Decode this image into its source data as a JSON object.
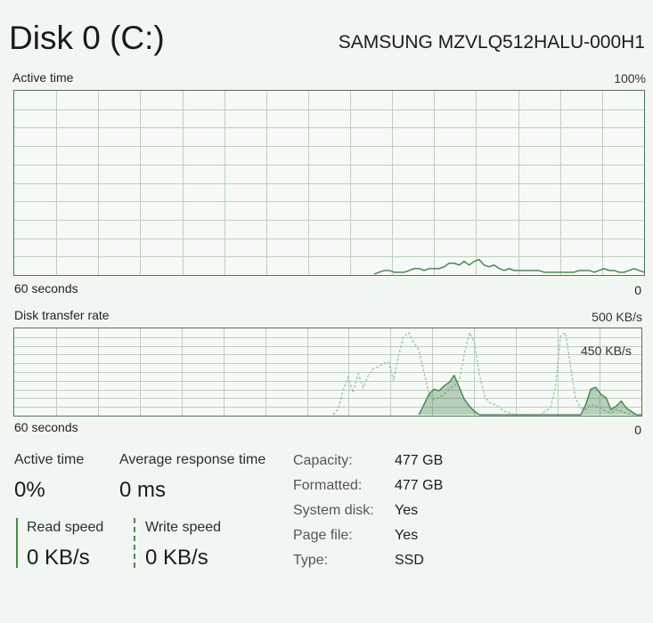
{
  "header": {
    "title": "Disk 0 (C:)",
    "model": "SAMSUNG MZVLQ512HALU-000H1"
  },
  "active_time_chart": {
    "label": "Active time",
    "max_label": "100%",
    "time_label": "60 seconds",
    "min_label": "0",
    "line_color": "#3f7d4a",
    "values": [
      0,
      0,
      0,
      0,
      0,
      0,
      0,
      0,
      0,
      0,
      0,
      0,
      0,
      0,
      0,
      0,
      0,
      0,
      0,
      0,
      0,
      0,
      0,
      0,
      0,
      0,
      0,
      0,
      0,
      0,
      0,
      0,
      0,
      0,
      0,
      0,
      0,
      0,
      0,
      0,
      0,
      0,
      0,
      0,
      0,
      0,
      0,
      0,
      0,
      0,
      0,
      0,
      0,
      0,
      0,
      0,
      0,
      0,
      0,
      0,
      0,
      0,
      0,
      0,
      0,
      0,
      0,
      0,
      0,
      0,
      0,
      0,
      0,
      1,
      2,
      2,
      1,
      1,
      1,
      2,
      3,
      3,
      2,
      3,
      3,
      3,
      4,
      6,
      6,
      5,
      7,
      5,
      7,
      8,
      5,
      4,
      5,
      3,
      2,
      3,
      2,
      2,
      2,
      2,
      2,
      2,
      1,
      1,
      1,
      1,
      1,
      1,
      1,
      2,
      2,
      2,
      1,
      2,
      3,
      2,
      2,
      1,
      1,
      2,
      3,
      2,
      1
    ]
  },
  "transfer_rate_chart": {
    "label": "Disk transfer rate",
    "max_label": "500 KB/s",
    "scale_label": "450 KB/s",
    "time_label": "60 seconds",
    "min_label": "0",
    "read_color": "#3f7d4a",
    "write_color": "#9cc79a",
    "write_values": [
      0,
      0,
      0,
      0,
      0,
      0,
      0,
      0,
      0,
      0,
      0,
      0,
      0,
      0,
      0,
      0,
      0,
      0,
      0,
      0,
      0,
      0,
      0,
      0,
      0,
      0,
      0,
      0,
      0,
      0,
      0,
      0,
      0,
      0,
      0,
      0,
      0,
      0,
      0,
      0,
      0,
      0,
      0,
      0,
      0,
      0,
      0,
      0,
      0,
      0,
      0,
      0,
      0,
      0,
      0,
      0,
      0,
      0,
      0,
      0,
      0,
      0,
      0,
      0,
      30,
      140,
      220,
      130,
      240,
      160,
      230,
      270,
      280,
      300,
      310,
      200,
      350,
      460,
      480,
      420,
      380,
      250,
      120,
      90,
      100,
      120,
      150,
      170,
      200,
      360,
      480,
      420,
      230,
      110,
      70,
      60,
      40,
      20,
      10,
      0,
      0,
      0,
      0,
      0,
      0,
      20,
      40,
      160,
      460,
      480,
      280,
      90,
      40,
      30,
      60,
      50,
      40,
      20,
      10,
      30,
      20,
      10,
      0,
      0,
      0
    ],
    "read_values": [
      0,
      0,
      0,
      0,
      0,
      0,
      0,
      0,
      0,
      0,
      0,
      0,
      0,
      0,
      0,
      0,
      0,
      0,
      0,
      0,
      0,
      0,
      0,
      0,
      0,
      0,
      0,
      0,
      0,
      0,
      0,
      0,
      0,
      0,
      0,
      0,
      0,
      0,
      0,
      0,
      0,
      0,
      0,
      0,
      0,
      0,
      0,
      0,
      0,
      0,
      0,
      0,
      0,
      0,
      0,
      0,
      0,
      0,
      0,
      0,
      0,
      0,
      0,
      0,
      0,
      0,
      0,
      0,
      0,
      0,
      0,
      0,
      0,
      0,
      0,
      0,
      0,
      0,
      0,
      0,
      0,
      60,
      120,
      150,
      140,
      170,
      190,
      230,
      160,
      90,
      50,
      20,
      0,
      0,
      0,
      0,
      0,
      0,
      0,
      0,
      0,
      0,
      0,
      0,
      0,
      0,
      0,
      0,
      0,
      0,
      0,
      0,
      0,
      60,
      150,
      160,
      120,
      100,
      30,
      50,
      80,
      40,
      20,
      0,
      0
    ]
  },
  "stats": {
    "active_time_label": "Active time",
    "active_time_value": "0%",
    "avg_response_label": "Average response time",
    "avg_response_value": "0 ms",
    "read_speed_label": "Read speed",
    "read_speed_value": "0 KB/s",
    "write_speed_label": "Write speed",
    "write_speed_value": "0 KB/s"
  },
  "properties": {
    "capacity_label": "Capacity:",
    "capacity_value": "477 GB",
    "formatted_label": "Formatted:",
    "formatted_value": "477 GB",
    "system_disk_label": "System disk:",
    "system_disk_value": "Yes",
    "page_file_label": "Page file:",
    "page_file_value": "Yes",
    "type_label": "Type:",
    "type_value": "SSD"
  }
}
